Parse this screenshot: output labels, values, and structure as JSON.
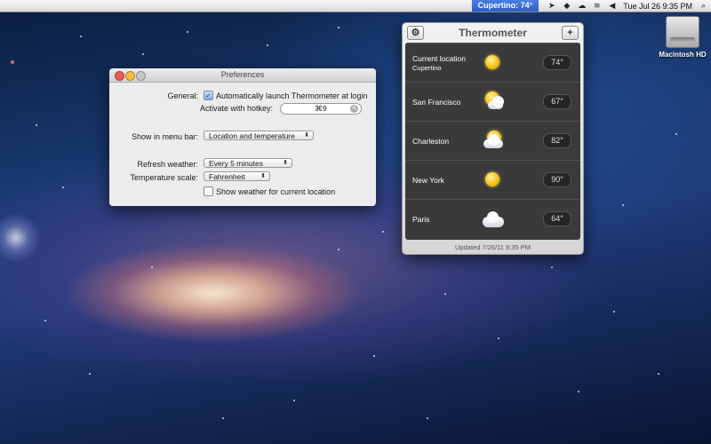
{
  "menubar": {
    "thermometer_item": "Cupertino: 74°",
    "status_icons": [
      "location-icon",
      "dropbox-icon",
      "cloud-icon",
      "wifi-icon",
      "volume-icon"
    ],
    "clock": "Tue Jul 26  9:35 PM"
  },
  "desktop": {
    "disk_label": "Macintosh HD"
  },
  "preferences": {
    "title": "Preferences",
    "general_label": "General:",
    "auto_launch_label": "Automatically launch Thermometer at login",
    "auto_launch_checked": true,
    "hotkey_label": "Activate with hotkey:",
    "hotkey_value": "⌘9",
    "menu_bar_label": "Show in menu bar:",
    "menu_bar_value": "Location and temperature",
    "refresh_label": "Refresh weather:",
    "refresh_value": "Every 5 minutes",
    "scale_label": "Temperature scale:",
    "scale_value": "Fahrenheit",
    "current_location_label": "Show weather for current location",
    "current_location_checked": false
  },
  "thermometer": {
    "title": "Thermometer",
    "cities": [
      {
        "name": "Current location",
        "sub": "Cupertino",
        "temp": "74°",
        "icon": "sun-icon"
      },
      {
        "name": "San Francisco",
        "temp": "67°",
        "icon": "partly-cloudy-icon"
      },
      {
        "name": "Charleston",
        "temp": "82°",
        "icon": "partly-cloudy-icon"
      },
      {
        "name": "New York",
        "temp": "90°",
        "icon": "sun-icon"
      },
      {
        "name": "Paris",
        "temp": "64°",
        "icon": "cloud-icon"
      }
    ],
    "updated": "Updated 7/26/11 9:35 PM"
  },
  "colors": {
    "menubar_highlight": "#2f5ec9",
    "list_bg": "#3a3a3a"
  }
}
